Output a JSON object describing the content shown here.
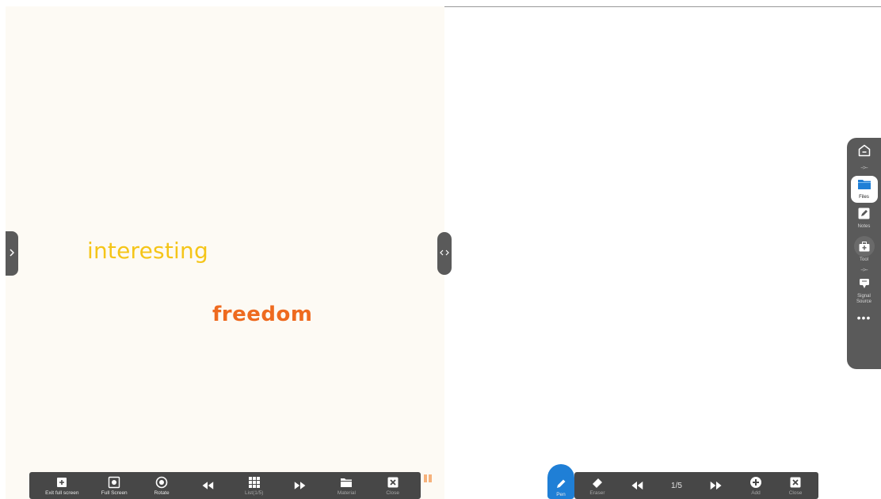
{
  "left_canvas": {
    "words": {
      "interesting": "interesting",
      "freedom": "freedom"
    },
    "colors": {
      "background": "#fdfaf4",
      "interesting": "#f5c518",
      "freedom": "#ee6a1f"
    }
  },
  "left_toolbar": {
    "items": [
      {
        "label": "Exit full screen",
        "icon": "exit-fullscreen-icon"
      },
      {
        "label": "Full Screen",
        "icon": "fullscreen-icon"
      },
      {
        "label": "Rotate",
        "icon": "rotate-icon"
      },
      {
        "label": "",
        "icon": "rewind-icon"
      },
      {
        "label": "List(1/5)",
        "icon": "grid-icon"
      },
      {
        "label": "",
        "icon": "fast-forward-icon"
      },
      {
        "label": "Material",
        "icon": "folder-icon"
      },
      {
        "label": "Close",
        "icon": "close-icon"
      }
    ]
  },
  "right_toolbar": {
    "pen": {
      "label": "Pen",
      "icon": "pen-icon"
    },
    "eraser": {
      "label": "Eraser",
      "icon": "eraser-icon"
    },
    "page_indicator": "1/5",
    "add": {
      "label": "Add",
      "icon": "plus-icon"
    },
    "close": {
      "label": "Close",
      "icon": "close-icon"
    },
    "active_color": "#1f7fd6"
  },
  "sidebar": {
    "items": [
      {
        "label": "",
        "icon": "home-icon"
      },
      {
        "label": "Files",
        "icon": "folder-icon"
      },
      {
        "label": "Notes",
        "icon": "note-icon"
      },
      {
        "label": "Tool",
        "icon": "toolbox-icon"
      },
      {
        "label": "Signal Source",
        "icon": "signal-source-icon"
      }
    ],
    "more": "•••"
  }
}
